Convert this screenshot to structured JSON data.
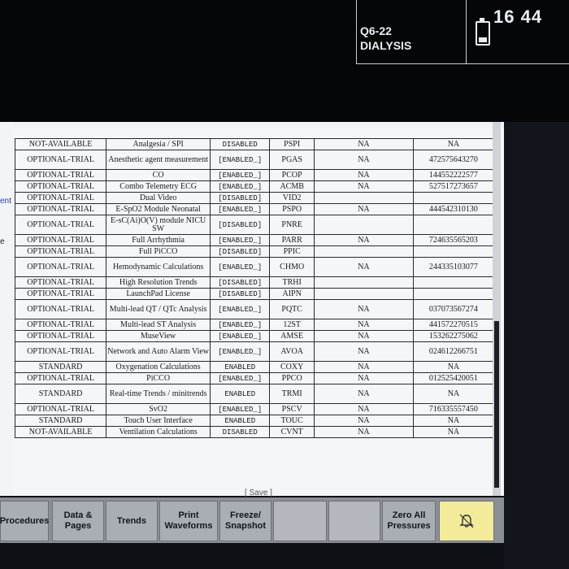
{
  "status": {
    "bed_line": "Q6-22",
    "care_unit": "DIALYSIS",
    "time": "16 44",
    "battery_icon": "battery-icon"
  },
  "sidebar": {
    "fragments": [
      "ent",
      "e"
    ]
  },
  "table": {
    "rows": [
      {
        "license": "NOT-AVAILABLE",
        "name": "Analgesia / SPI",
        "state": "DISABLED",
        "code": "PSPI",
        "na": "NA",
        "key": "NA",
        "size": "sm"
      },
      {
        "license": "OPTIONAL-TRIAL",
        "name": "Anesthetic agent measurement",
        "state": "[ENABLED_]",
        "code": "PGAS",
        "na": "NA",
        "key": "472575643270",
        "size": "lg"
      },
      {
        "license": "OPTIONAL-TRIAL",
        "name": "CO",
        "state": "[ENABLED_]",
        "code": "PCOP",
        "na": "NA",
        "key": "144552222577",
        "size": "sm"
      },
      {
        "license": "OPTIONAL-TRIAL",
        "name": "Combo Telemetry ECG",
        "state": "[ENABLED_]",
        "code": "ACMB",
        "na": "NA",
        "key": "527517273657",
        "size": "sm"
      },
      {
        "license": "OPTIONAL-TRIAL",
        "name": "Dual Video",
        "state": "[DISABLED]",
        "code": "VID2",
        "na": "",
        "key": "",
        "size": "sm"
      },
      {
        "license": "OPTIONAL-TRIAL",
        "name": "E-SpO2 Module Neonatal",
        "state": "[ENABLED_]",
        "code": "PSPO",
        "na": "NA",
        "key": "444542310130",
        "size": "sm"
      },
      {
        "license": "OPTIONAL-TRIAL",
        "name": "E-sC(Ai)O(V) module NICU SW",
        "state": "[DISABLED]",
        "code": "PNRE",
        "na": "",
        "key": "",
        "size": "lg"
      },
      {
        "license": "OPTIONAL-TRIAL",
        "name": "Full Arrhythmia",
        "state": "[ENABLED_]",
        "code": "PARR",
        "na": "NA",
        "key": "724635565203",
        "size": "sm"
      },
      {
        "license": "OPTIONAL-TRIAL",
        "name": "Full PiCCO",
        "state": "[DISABLED]",
        "code": "PPIC",
        "na": "",
        "key": "",
        "size": "sm"
      },
      {
        "license": "OPTIONAL-TRIAL",
        "name": "Hemodynamic Calculations",
        "state": "[ENABLED_]",
        "code": "CHMO",
        "na": "NA",
        "key": "244335103077",
        "size": "lg"
      },
      {
        "license": "OPTIONAL-TRIAL",
        "name": "High Resolution Trends",
        "state": "[DISABLED]",
        "code": "TRHI",
        "na": "",
        "key": "",
        "size": "sm"
      },
      {
        "license": "OPTIONAL-TRIAL",
        "name": "LaunchPad License",
        "state": "[DISABLED]",
        "code": "AIPN",
        "na": "",
        "key": "",
        "size": "sm"
      },
      {
        "license": "OPTIONAL-TRIAL",
        "name": "Multi-lead QT / QTc Analysis",
        "state": "[ENABLED_]",
        "code": "PQTC",
        "na": "NA",
        "key": "037073567274",
        "size": "lg"
      },
      {
        "license": "OPTIONAL-TRIAL",
        "name": "Multi-lead ST Analysis",
        "state": "[ENABLED_]",
        "code": "12ST",
        "na": "NA",
        "key": "441572270515",
        "size": "sm"
      },
      {
        "license": "OPTIONAL-TRIAL",
        "name": "MuseView",
        "state": "[ENABLED_]",
        "code": "AMSE",
        "na": "NA",
        "key": "153262275062",
        "size": "sm"
      },
      {
        "license": "OPTIONAL-TRIAL",
        "name": "Network and Auto Alarm View",
        "state": "[ENABLED_]",
        "code": "AVOA",
        "na": "NA",
        "key": "024612266751",
        "size": "lg"
      },
      {
        "license": "STANDARD",
        "name": "Oxygenation Calculations",
        "state": "ENABLED",
        "code": "COXY",
        "na": "NA",
        "key": "NA",
        "size": "sm"
      },
      {
        "license": "OPTIONAL-TRIAL",
        "name": "PiCCO",
        "state": "[ENABLED_]",
        "code": "PPCO",
        "na": "NA",
        "key": "012525420051",
        "size": "sm"
      },
      {
        "license": "STANDARD",
        "name": "Real-time Trends / minitrends",
        "state": "ENABLED",
        "code": "TRMI",
        "na": "NA",
        "key": "NA",
        "size": "lg"
      },
      {
        "license": "OPTIONAL-TRIAL",
        "name": "SvO2",
        "state": "[ENABLED_]",
        "code": "PSCV",
        "na": "NA",
        "key": "716335557450",
        "size": "sm"
      },
      {
        "license": "STANDARD",
        "name": "Touch User Interface",
        "state": "ENABLED",
        "code": "TOUC",
        "na": "NA",
        "key": "NA",
        "size": "sm"
      },
      {
        "license": "NOT-AVAILABLE",
        "name": "Ventilation Calculations",
        "state": "DISABLED",
        "code": "CVNT",
        "na": "NA",
        "key": "NA",
        "size": "sm"
      }
    ]
  },
  "save_label": "[ Save ]",
  "softkeys": {
    "procedures": "Procedures",
    "data_pages": "Data & Pages",
    "trends": "Trends",
    "print_waveforms": "Print Waveforms",
    "freeze_snapshot": "Freeze/ Snapshot",
    "zero_all": "Zero All Pressures",
    "alarm_icon": "bell-icon"
  }
}
